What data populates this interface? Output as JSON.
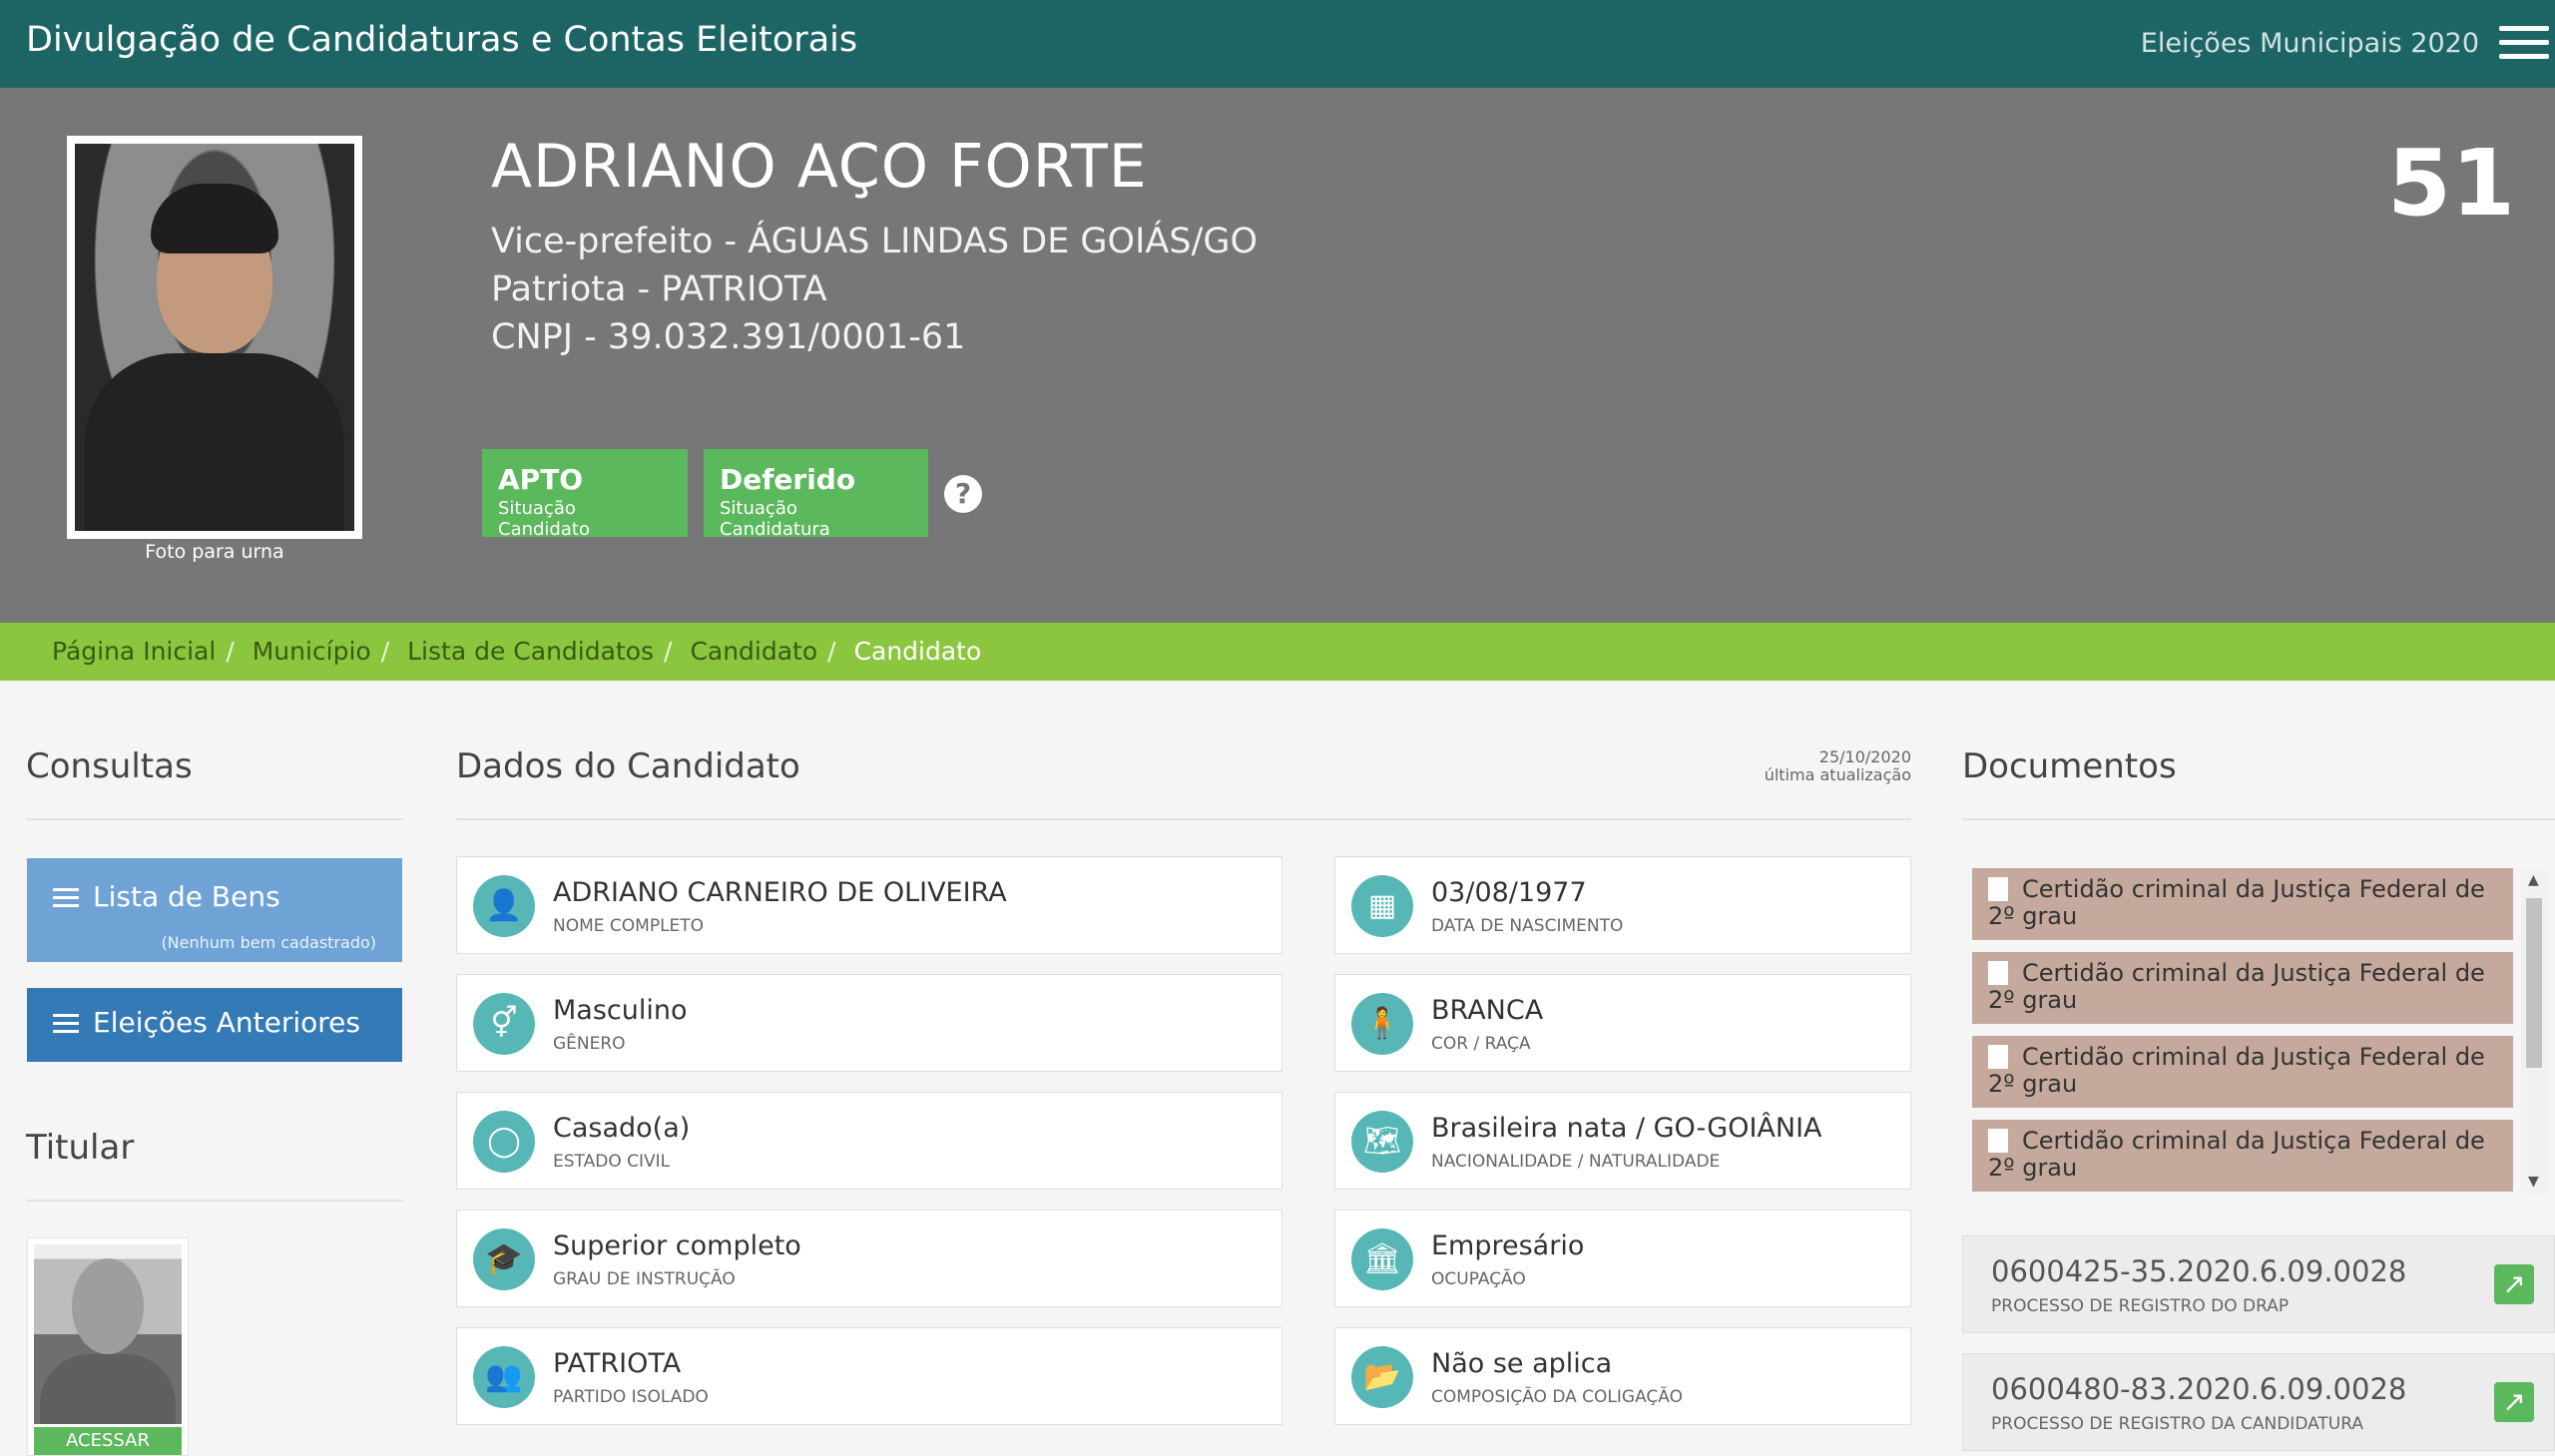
{
  "topbar": {
    "title": "Divulgação de Candidaturas e Contas Eleitorais",
    "election": "Eleições Municipais 2020"
  },
  "candidate": {
    "name": "ADRIANO AÇO FORTE",
    "role": "Vice-prefeito - ÁGUAS LINDAS DE GOIÁS/GO",
    "party": "Patriota - PATRIOTA",
    "cnpj": "CNPJ - 39.032.391/0001-61",
    "number": "51",
    "photo_caption": "Foto para urna",
    "status": [
      {
        "value": "APTO",
        "label": "Situação Candidato"
      },
      {
        "value": "Deferido",
        "label": "Situação Candidatura"
      }
    ],
    "help": "?"
  },
  "breadcrumb": [
    "Página Inicial",
    "Município",
    "Lista de Candidatos",
    "Candidato",
    "Candidato"
  ],
  "consultas": {
    "title": "Consultas",
    "bens_label": "Lista de Bens",
    "bens_note": "(Nenhum bem cadastrado)",
    "eleicoes_label": "Eleições Anteriores"
  },
  "titular": {
    "title": "Titular",
    "button": "ACESSAR"
  },
  "dados": {
    "title": "Dados do Candidato",
    "updated_date": "25/10/2020",
    "updated_label": "última atualização",
    "left": [
      {
        "value": "ADRIANO CARNEIRO DE OLIVEIRA",
        "label": "NOME COMPLETO",
        "icon": "user-icon"
      },
      {
        "value": "Masculino",
        "label": "GÊNERO",
        "icon": "gender-icon"
      },
      {
        "value": "Casado(a)",
        "label": "ESTADO CIVIL",
        "icon": "ring-icon"
      },
      {
        "value": "Superior completo",
        "label": "GRAU DE INSTRUÇÃO",
        "icon": "graduation-cap-icon"
      },
      {
        "value": "PATRIOTA",
        "label": "PARTIDO ISOLADO",
        "icon": "group-icon"
      }
    ],
    "right": [
      {
        "value": "03/08/1977",
        "label": "DATA DE NASCIMENTO",
        "icon": "calendar-icon"
      },
      {
        "value": "BRANCA",
        "label": "COR / RAÇA",
        "icon": "person-icon"
      },
      {
        "value": "Brasileira nata / GO-GOIÂNIA",
        "label": "NACIONALIDADE / NATURALIDADE",
        "icon": "map-icon"
      },
      {
        "value": "Empresário",
        "label": "OCUPAÇÃO",
        "icon": "bank-icon"
      },
      {
        "value": "Não se aplica",
        "label": "COMPOSIÇÃO DA COLIGAÇÃO",
        "icon": "folder-open-icon"
      }
    ]
  },
  "documentos": {
    "title": "Documentos",
    "items": [
      "Certidão criminal da Justiça Federal de 2º grau",
      "Certidão criminal da Justiça Federal de 2º grau",
      "Certidão criminal da Justiça Federal de 2º grau",
      "Certidão criminal da Justiça Federal de 2º grau"
    ],
    "processos": [
      {
        "value": "0600425-35.2020.6.09.0028",
        "label": "PROCESSO DE REGISTRO DO DRAP"
      },
      {
        "value": "0600480-83.2020.6.09.0028",
        "label": "PROCESSO DE REGISTRO DA CANDIDATURA"
      }
    ]
  }
}
